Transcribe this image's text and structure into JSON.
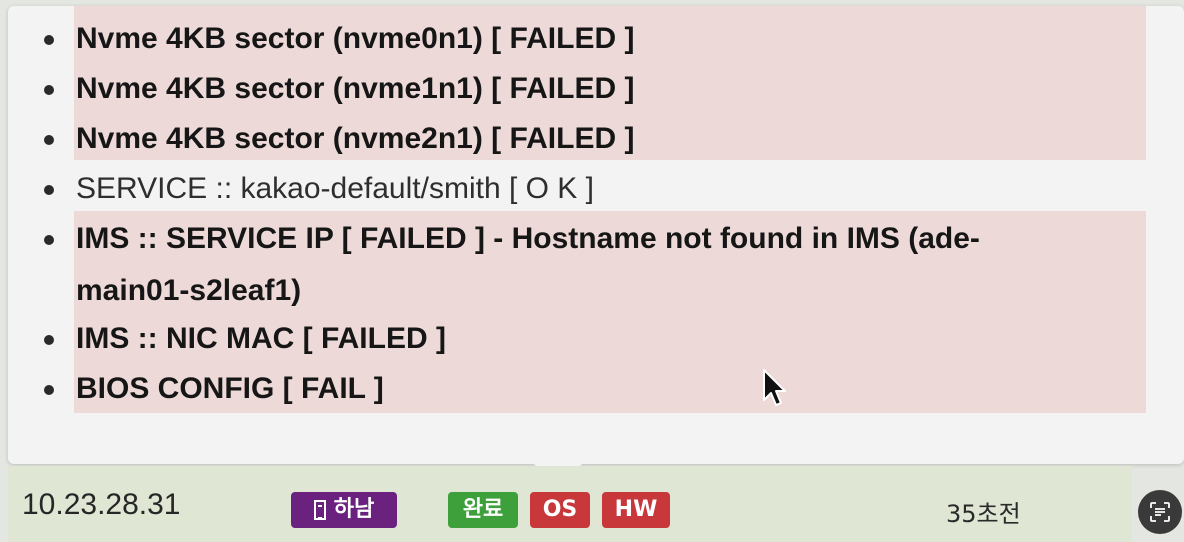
{
  "popup": {
    "items": [
      {
        "text": "Nvme 4KB sector (nvme0n1) [ FAILED ]",
        "status": "failed"
      },
      {
        "text": "Nvme 4KB sector (nvme1n1) [ FAILED ]",
        "status": "failed"
      },
      {
        "text": "Nvme 4KB sector (nvme2n1) [ FAILED ]",
        "status": "failed"
      },
      {
        "text": "SERVICE :: kakao-default/smith [ O K ]",
        "status": "ok"
      },
      {
        "text_line1": "IMS :: SERVICE IP [ FAILED ] - Hostname not found in IMS (ade-",
        "text_line2": "main01-s2leaf1)",
        "status": "failed"
      },
      {
        "text": "IMS :: NIC MAC [ FAILED ]",
        "status": "failed"
      },
      {
        "text": "BIOS CONFIG [ FAIL ]",
        "status": "failed"
      }
    ],
    "highlight_color": "#ecd9d8"
  },
  "statusbar": {
    "ip": "10.23.28.31",
    "badges": {
      "location": {
        "label": "하남",
        "icon": "building-icon",
        "color": "#6a227e"
      },
      "done": {
        "label": "완료",
        "color": "#3ea03a"
      },
      "os": {
        "label": "OS",
        "color": "#c8373a"
      },
      "hw": {
        "label": "HW",
        "color": "#c8373a"
      }
    },
    "time_ago": "35초전"
  },
  "overlay": {
    "lens_icon": "text-scan-icon",
    "cursor_icon": "mouse-pointer-icon"
  }
}
